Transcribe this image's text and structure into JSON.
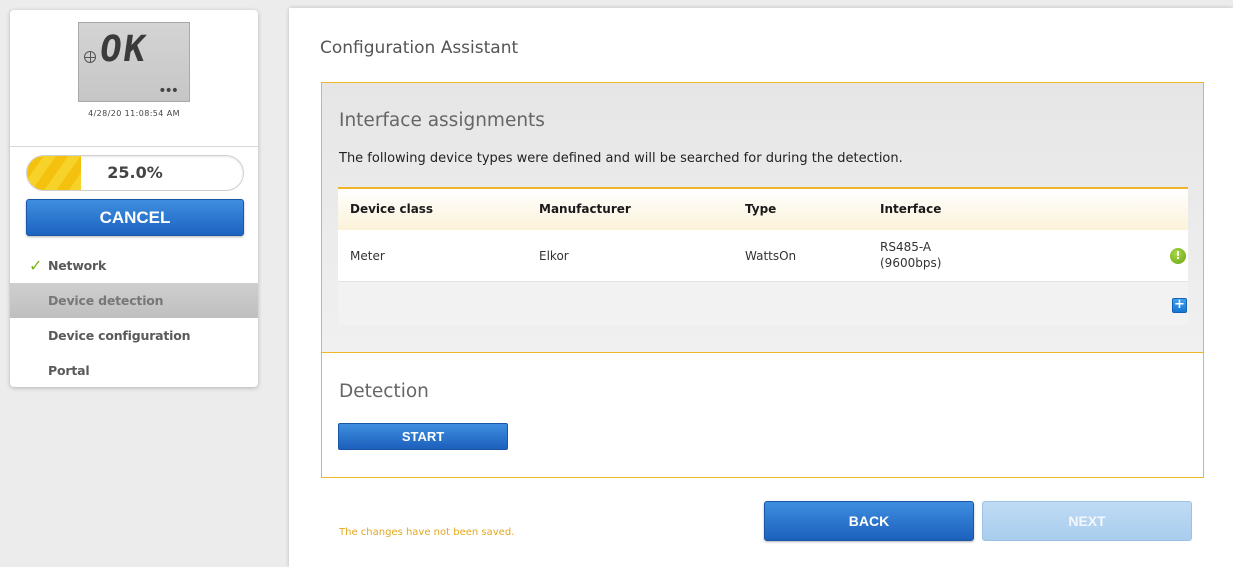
{
  "sidebar": {
    "lcd_text": "OK",
    "lcd_dots": "•••",
    "datetime": "4/28/20 11:08:54 AM",
    "progress": {
      "label": "25.0%",
      "percent": 25
    },
    "cancel_label": "CANCEL",
    "steps": [
      {
        "label": "Network",
        "done": true
      },
      {
        "label": "Device detection",
        "active": true
      },
      {
        "label": "Device configuration"
      },
      {
        "label": "Portal"
      }
    ]
  },
  "main": {
    "title": "Configuration Assistant",
    "interface": {
      "heading": "Interface assignments",
      "description": "The following device types were defined and will be searched for during the detection.",
      "columns": [
        "Device class",
        "Manufacturer",
        "Type",
        "Interface"
      ],
      "rows": [
        {
          "device_class": "Meter",
          "manufacturer": "Elkor",
          "type": "WattsOn",
          "interface_line1": "RS485-A",
          "interface_line2": "(9600bps)"
        }
      ]
    },
    "detection": {
      "heading": "Detection",
      "start_label": "START"
    },
    "unsaved_notice": "The changes have not been saved.",
    "back_label": "BACK",
    "next_label": "NEXT"
  },
  "colors": {
    "accent_border": "#f0b62b",
    "button_blue": "#1d63c0",
    "button_disabled": "#a9cdee",
    "check_green": "#7bb31a"
  },
  "icons": {
    "check": "check-icon",
    "warning": "warning-icon",
    "add": "add-icon",
    "globe": "globe-icon"
  }
}
